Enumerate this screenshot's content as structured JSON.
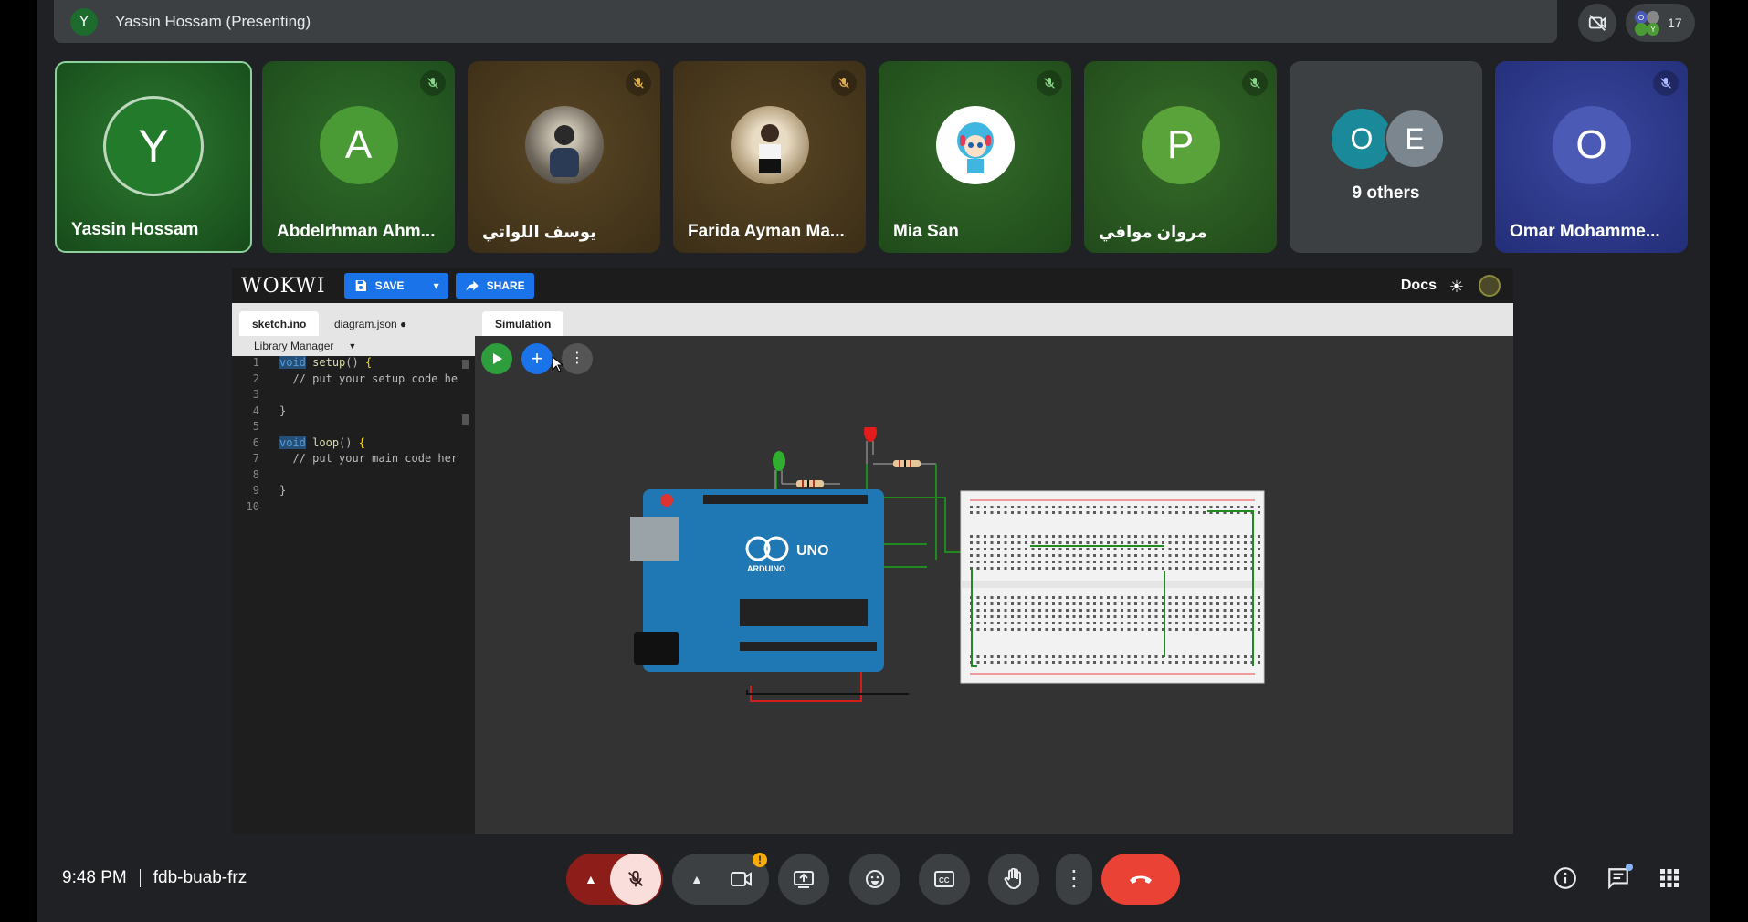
{
  "meeting": {
    "presenter_initial": "Y",
    "presenting_title": "Yassin Hossam (Presenting)",
    "participant_count": "17",
    "time": "9:48 PM",
    "meeting_code": "fdb-buab-frz"
  },
  "tiles": [
    {
      "name": "Yassin Hossam",
      "initial": "Y",
      "bg": "#1d5e22",
      "avatar_bg": "#257a2c"
    },
    {
      "name": "Abdelrhman Ahm...",
      "initial": "A",
      "bg": "#235a24",
      "avatar_bg": "#4a9a35"
    },
    {
      "name": "يوسف اللواتي",
      "initial": "",
      "bg": "#4a3a1f",
      "avatar_bg": "#8a7a66"
    },
    {
      "name": "Farida Ayman Ma...",
      "initial": "",
      "bg": "#4b3a20",
      "avatar_bg": "#c9b89a"
    },
    {
      "name": "Mia San",
      "initial": "",
      "bg": "#2c5a24",
      "avatar_bg": "#ffffff"
    },
    {
      "name": "مروان موافي",
      "initial": "P",
      "bg": "#2f5a23",
      "avatar_bg": "#5aa33a"
    },
    {
      "name": "9 others",
      "initial": "",
      "bg": "#3c4043",
      "avatar_bg": ""
    },
    {
      "name": "Omar Mohamme...",
      "initial": "O",
      "bg": "#2e3b8a",
      "avatar_bg": "#4a5ab5"
    }
  ],
  "others": {
    "a": "O",
    "b": "E"
  },
  "wokwi": {
    "logo": "WOKWI",
    "save_label": "SAVE",
    "share_label": "SHARE",
    "docs_label": "Docs",
    "tabs": [
      "sketch.ino",
      "diagram.json ●"
    ],
    "library_manager": "Library Manager",
    "simulation_tab": "Simulation",
    "board_label": "UNO",
    "brand_label": "ARDUINO",
    "code_line_numbers": [
      "1",
      "2",
      "3",
      "4",
      "5",
      "6",
      "7",
      "8",
      "9",
      "10"
    ]
  },
  "colors": {
    "meet_bg": "#202124",
    "control_bg": "#3c4043",
    "end_call": "#ea4335",
    "mic_off": "#f9dedc",
    "wokwi_blue": "#1a73e8",
    "arduino_blue": "#1f78b4"
  }
}
